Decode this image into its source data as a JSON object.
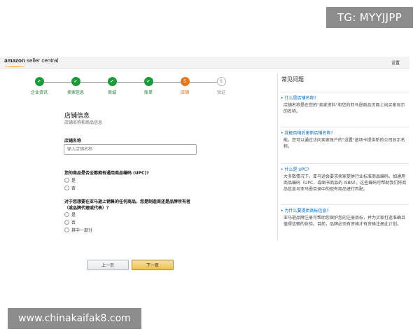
{
  "overlay": {
    "tg_badge": "TG: MYYJJPP",
    "watermark": "www.chinakaifak8.com"
  },
  "header": {
    "logo_bold": "amazon",
    "logo_rest": " seller central",
    "settings": "设置"
  },
  "steps": [
    {
      "label": "企业资讯",
      "status": "done"
    },
    {
      "label": "卖家信息",
      "status": "done"
    },
    {
      "label": "商城",
      "status": "done"
    },
    {
      "label": "账单",
      "status": "done"
    },
    {
      "label": "店铺",
      "number": "5",
      "status": "current"
    },
    {
      "label": "验证",
      "number": "6",
      "status": "todo"
    }
  ],
  "form": {
    "title": "店铺信息",
    "subtitle": "店铺名称和商品信息",
    "store_name_label": "店铺名称",
    "store_name_placeholder": "输入店铺名称",
    "q1": "您的商品是否全都拥有通用商品编码 (UPC)?",
    "q1_options": [
      "是",
      "否"
    ],
    "q2_line1": "对于您想要在亚马逊上销售的任何商品，您是制造商还是品牌所有者",
    "q2_line2": "（或品牌代理或代表）？",
    "q2_options": [
      "是",
      "否",
      "其中一部分"
    ],
    "prev_button": "上一页",
    "next_button": "下一页"
  },
  "faq": {
    "title": "常见问题",
    "items": [
      {
        "q": "• 什么是店铺名称?",
        "a": "店铺名称是在您的\"卖家资料\"和您的亚马逊商品页面上向买家显示的名称。"
      },
      {
        "q": "• 我能否稍后更新店铺名称?",
        "a": "能。您可以通过访问卖家账户的\"设置\"选项卡提供新的公司显示名称。"
      },
      {
        "q": "• 什么是 UPC?",
        "a": "大多数情况下，亚马逊会要求卖家提供行业标准商品编码。如通用商品编码（UPC、或图书商品的 ISBN）。这些编码可帮助我们将商品信息与亚马逊目录中的现有商品进行匹配。"
      },
      {
        "q": "• 为什么要提供商标信息?",
        "a": "亚马逊品牌注册可帮助您保护您的注册商标，并为买家打造准确且值得信赖的体验。目前，品牌必须有资格才有资格注册此计划。"
      }
    ]
  }
}
